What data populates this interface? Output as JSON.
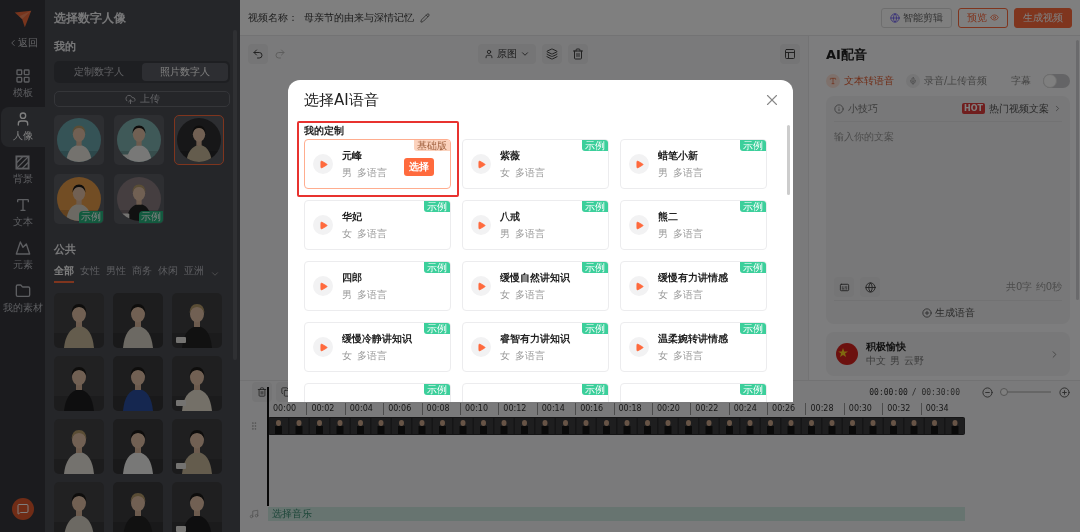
{
  "nav": {
    "back": "返回",
    "items": [
      {
        "kind": "layout",
        "label": "模板",
        "selected": false
      },
      {
        "kind": "person",
        "label": "人像",
        "selected": true
      },
      {
        "kind": "background",
        "label": "背景",
        "selected": false
      },
      {
        "kind": "text",
        "label": "文本",
        "selected": false
      },
      {
        "kind": "element",
        "label": "元素",
        "selected": false
      },
      {
        "kind": "folder",
        "label": "我的素材",
        "selected": false
      }
    ]
  },
  "avatar_panel": {
    "title": "选择数字人像",
    "mine_heading": "我的",
    "tabs": [
      {
        "label": "定制数字人",
        "selected": false
      },
      {
        "label": "照片数字人",
        "selected": true
      }
    ],
    "upload": "上传",
    "my_avatars": [
      {
        "kind": "picture",
        "selected": false
      },
      {
        "kind": "picture",
        "selected": false
      },
      {
        "kind": "picture",
        "selected": true
      },
      {
        "kind": "picture",
        "selected": false,
        "badge": "示例"
      },
      {
        "kind": "picture",
        "selected": false,
        "badge": "示例"
      }
    ],
    "public_heading": "公共",
    "filters": [
      {
        "label": "全部",
        "selected": true
      },
      {
        "label": "女性",
        "selected": false
      },
      {
        "label": "男性",
        "selected": false
      },
      {
        "label": "商务",
        "selected": false
      },
      {
        "label": "休闲",
        "selected": false
      },
      {
        "label": "亚洲",
        "selected": false
      }
    ],
    "public_avatars": [
      {
        "kind": "picture"
      },
      {
        "kind": "picture"
      },
      {
        "kind": "picture"
      },
      {
        "kind": "picture"
      },
      {
        "kind": "picture"
      },
      {
        "kind": "picture"
      },
      {
        "kind": "picture"
      },
      {
        "kind": "picture"
      },
      {
        "kind": "picture"
      },
      {
        "kind": "picture"
      },
      {
        "kind": "picture"
      },
      {
        "kind": "picture"
      }
    ]
  },
  "topbar": {
    "name_label": "视频名称：",
    "name": "母亲节的由来与深情记忆",
    "buttons": [
      {
        "kind": "ai",
        "label": "智能剪辑"
      },
      {
        "kind": "outline",
        "label": "预览"
      },
      {
        "kind": "primary",
        "label": "生成视频"
      }
    ]
  },
  "toolbar": {
    "view": "原图"
  },
  "dubbing": {
    "title": "AI配音",
    "tabs": [
      {
        "label": "文本转语音",
        "selected": true
      },
      {
        "label": "录音/上传音频",
        "selected": false
      }
    ],
    "subtitle": {
      "label": "字幕",
      "on": false
    },
    "tip": "小技巧",
    "hot_badge": "HOT",
    "hot_link": "热门视频文案",
    "placeholder": "输入你的文案",
    "count": "共0字 约0秒",
    "generate": "生成语音",
    "voice": {
      "name": "积极愉快",
      "language": "中文",
      "gender": "男",
      "speaker": "云野"
    }
  },
  "timeline": {
    "current": "00:00:00",
    "total": "/ 00:30:00",
    "zoom": {
      "level": 0.05
    },
    "ticks": [
      "00:00",
      "00:02",
      "00:04",
      "00:06",
      "00:08",
      "00:10",
      "00:12",
      "00:14",
      "00:16",
      "00:18",
      "00:20",
      "00:22",
      "00:24",
      "00:26",
      "00:28",
      "00:30",
      "00:32",
      "00:34"
    ],
    "music": "选择音乐"
  },
  "modal": {
    "title": "选择AI语音",
    "custom_section": {
      "title": "我的定制",
      "voices": [
        {
          "name": "元峰",
          "gender": "男",
          "language": "多语言",
          "badge": "基础版",
          "selected": true,
          "action": "选择"
        }
      ]
    },
    "voices": [
      {
        "name": "紫薇",
        "gender": "女",
        "language": "多语言",
        "badge": "示例",
        "selected": false
      },
      {
        "name": "蜡笔小新",
        "gender": "男",
        "language": "多语言",
        "badge": "示例",
        "selected": false
      },
      {
        "name": "华妃",
        "gender": "女",
        "language": "多语言",
        "badge": "示例",
        "selected": false
      },
      {
        "name": "八戒",
        "gender": "男",
        "language": "多语言",
        "badge": "示例",
        "selected": false
      },
      {
        "name": "熊二",
        "gender": "男",
        "language": "多语言",
        "badge": "示例",
        "selected": false
      },
      {
        "name": "四郎",
        "gender": "男",
        "language": "多语言",
        "badge": "示例",
        "selected": false
      },
      {
        "name": "缓慢自然讲知识",
        "gender": "女",
        "language": "多语言",
        "badge": "示例",
        "selected": false
      },
      {
        "name": "缓慢有力讲情感",
        "gender": "女",
        "language": "多语言",
        "badge": "示例",
        "selected": false
      },
      {
        "name": "缓慢冷静讲知识",
        "gender": "女",
        "language": "多语言",
        "badge": "示例",
        "selected": false
      },
      {
        "name": "睿智有力讲知识",
        "gender": "女",
        "language": "多语言",
        "badge": "示例",
        "selected": false
      },
      {
        "name": "温柔婉转讲情感",
        "gender": "女",
        "language": "多语言",
        "badge": "示例",
        "selected": false
      },
      {
        "kind": "partial",
        "badge": "示例",
        "selected": false
      },
      {
        "kind": "partial",
        "badge": "示例",
        "selected": false
      },
      {
        "kind": "partial",
        "badge": "示例",
        "selected": false
      }
    ]
  }
}
